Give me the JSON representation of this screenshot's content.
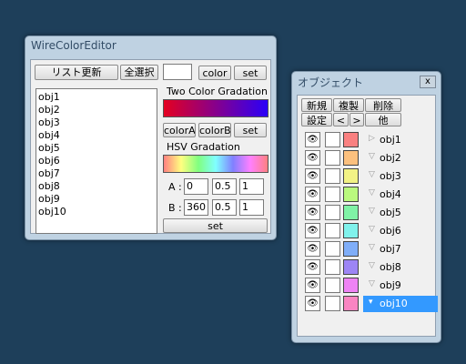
{
  "wire_editor": {
    "title": "WireColorEditor",
    "refresh_label": "リスト更新",
    "select_all_label": "全選択",
    "objects": [
      "obj1",
      "obj2",
      "obj3",
      "obj4",
      "obj5",
      "obj6",
      "obj7",
      "obj8",
      "obj9",
      "obj10"
    ],
    "color_label": "color",
    "set_label": "set",
    "two_color_title": "Two Color Gradation",
    "color_a_label": "colorA",
    "color_b_label": "colorB",
    "two_set_label": "set",
    "hsv_title": "HSV Gradation",
    "a_label": "A :",
    "a_values": [
      "0",
      "0.5",
      "1"
    ],
    "b_label": "B :",
    "b_values": [
      "360",
      "0.5",
      "1"
    ],
    "hsv_set_label": "set"
  },
  "object_panel": {
    "title": "オブジェクト",
    "close_label": "x",
    "buttons": [
      "新規",
      "複製",
      "削除"
    ],
    "settings_label": "設定",
    "prev_label": "<",
    "next_label": ">",
    "other_label": "他",
    "items": [
      {
        "name": "obj1",
        "color": "#f98080"
      },
      {
        "name": "obj2",
        "color": "#fbc07e"
      },
      {
        "name": "obj3",
        "color": "#f2f285"
      },
      {
        "name": "obj4",
        "color": "#baf97e"
      },
      {
        "name": "obj5",
        "color": "#80f2a6"
      },
      {
        "name": "obj6",
        "color": "#80f2ec"
      },
      {
        "name": "obj7",
        "color": "#80aef8"
      },
      {
        "name": "obj8",
        "color": "#9d85f5"
      },
      {
        "name": "obj9",
        "color": "#ee83f4"
      },
      {
        "name": "obj10",
        "color": "#f985c2"
      }
    ],
    "selected_index": 9
  }
}
